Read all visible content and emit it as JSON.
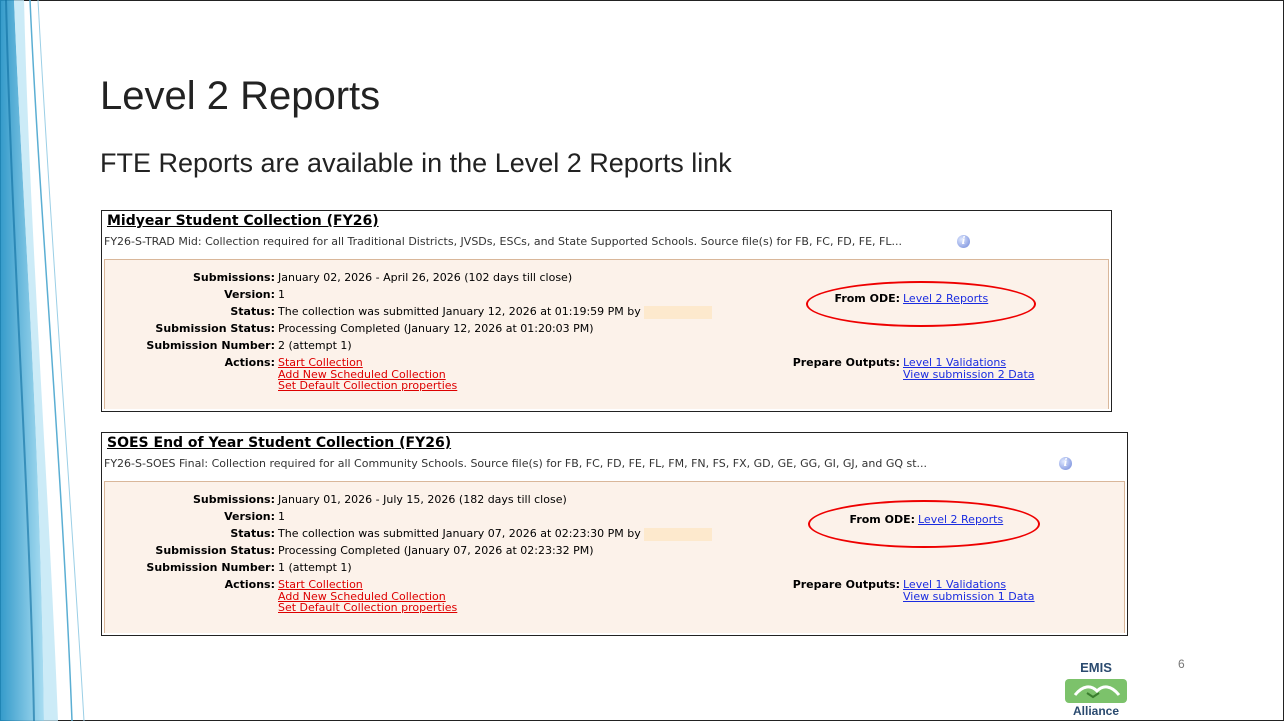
{
  "slide": {
    "title": "Level 2 Reports",
    "subtitle": "FTE Reports are available in the Level 2 Reports link",
    "page_number": "6"
  },
  "logo": {
    "top": "EMIS",
    "bottom": "Alliance"
  },
  "collections": [
    {
      "header": "Midyear Student Collection (FY26)",
      "description": "FY26-S-TRAD Mid: Collection required for all Traditional Districts, JVSDs, ESCs, and State Supported Schools. Source file(s) for FB, FC, FD, FE, FL...",
      "submissions_label": "Submissions:",
      "submissions": "January 02, 2026 - April 26, 2026 (102 days till close)",
      "version_label": "Version:",
      "version": "1",
      "status_label": "Status:",
      "status": "The collection was submitted January 12, 2026 at 01:19:59 PM by",
      "submission_status_label": "Submission Status:",
      "submission_status": "Processing Completed (January 12, 2026 at 01:20:03 PM)",
      "submission_number_label": "Submission Number:",
      "submission_number": "2 (attempt 1)",
      "actions_label": "Actions:",
      "actions": [
        "Start Collection",
        "Add New Scheduled Collection",
        "Set Default Collection properties"
      ],
      "from_ode_label": "From ODE:",
      "from_ode_link": "Level 2 Reports",
      "prepare_outputs_label": "Prepare Outputs:",
      "prepare_outputs": [
        "Level 1 Validations",
        "View submission 2 Data"
      ]
    },
    {
      "header": "SOES End of Year Student Collection (FY26)",
      "description": "FY26-S-SOES Final: Collection required for all Community Schools. Source file(s) for FB, FC, FD, FE, FL, FM, FN, FS, FX, GD, GE, GG, GI, GJ, and GQ st...",
      "submissions_label": "Submissions:",
      "submissions": "January 01, 2026 - July 15, 2026 (182 days till close)",
      "version_label": "Version:",
      "version": "1",
      "status_label": "Status:",
      "status": "The collection was submitted January 07, 2026 at 02:23:30 PM by",
      "submission_status_label": "Submission Status:",
      "submission_status": "Processing Completed (January 07, 2026 at 02:23:32 PM)",
      "submission_number_label": "Submission Number:",
      "submission_number": "1 (attempt 1)",
      "actions_label": "Actions:",
      "actions": [
        "Start Collection",
        "Add New Scheduled Collection",
        "Set Default Collection properties"
      ],
      "from_ode_label": "From ODE:",
      "from_ode_link": "Level 2 Reports",
      "prepare_outputs_label": "Prepare Outputs:",
      "prepare_outputs": [
        "Level 1 Validations",
        "View submission 1 Data"
      ]
    }
  ],
  "colors": {
    "link_red": "#dd0000",
    "link_blue": "#1a2ce0",
    "panel_bg": "#fcf2ea",
    "highlight_oval": "#ee0000"
  }
}
